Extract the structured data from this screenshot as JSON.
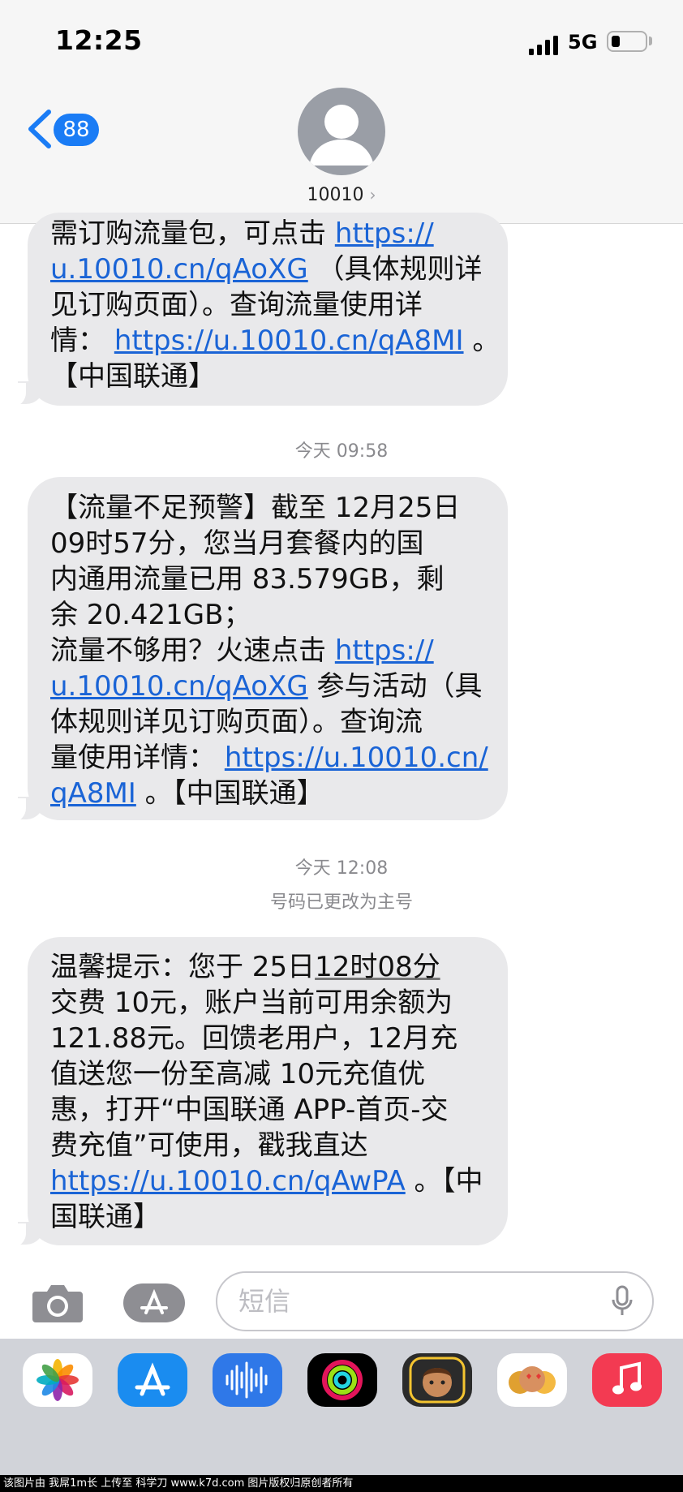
{
  "status_bar": {
    "time": "12:25",
    "carrier": "5G"
  },
  "header": {
    "badge_count": "88",
    "contact_name": "10010"
  },
  "messages": [
    {
      "lines": [
        [
          {
            "t": "需订购流量包，可点击 "
          },
          {
            "t": "https://",
            "link": true
          }
        ],
        [
          {
            "t": "u.10010.cn/qAoXG",
            "link": true
          },
          {
            "t": " （具体规则详"
          }
        ],
        [
          {
            "t": "见订购页面）。查询流量使用详"
          }
        ],
        [
          {
            "t": "情： "
          },
          {
            "t": "https://u.10010.cn/qA8MI",
            "link": true
          },
          {
            "t": " 。"
          }
        ],
        [
          {
            "t": "【中国联通】"
          }
        ]
      ]
    },
    {
      "lines": [
        [
          {
            "t": "【流量不足预警】截至 12月25日"
          }
        ],
        [
          {
            "t": "09时57分，您当月套餐内的国"
          }
        ],
        [
          {
            "t": "内通用流量已用 83.579GB，剩"
          }
        ],
        [
          {
            "t": "余 20.421GB；"
          }
        ],
        [
          {
            "t": "流量不够用？火速点击 "
          },
          {
            "t": "https://",
            "link": true
          }
        ],
        [
          {
            "t": "u.10010.cn/qAoXG",
            "link": true
          },
          {
            "t": " 参与活动（具"
          }
        ],
        [
          {
            "t": "体规则详见订购页面）。查询流"
          }
        ],
        [
          {
            "t": "量使用详情： "
          },
          {
            "t": "https://u.10010.cn/",
            "link": true
          }
        ],
        [
          {
            "t": "qA8MI",
            "link": true
          },
          {
            "t": " 。【中国联通】"
          }
        ]
      ]
    },
    {
      "lines": [
        [
          {
            "t": "温馨提示：您于 25日"
          },
          {
            "t": "12时08分",
            "under": true
          }
        ],
        [
          {
            "t": "交费 10元，账户当前可用余额为"
          }
        ],
        [
          {
            "t": "121.88元。回馈老用户，12月充"
          }
        ],
        [
          {
            "t": "值送您一份至高减 10元充值优"
          }
        ],
        [
          {
            "t": "惠，打开“中国联通 APP-首页-交"
          }
        ],
        [
          {
            "t": "费充值”可使用，戳我直达"
          }
        ],
        [
          {
            "t": "https://u.10010.cn/qAwPA",
            "link": true
          },
          {
            "t": " 。【中"
          }
        ],
        [
          {
            "t": "国联通】"
          }
        ]
      ]
    }
  ],
  "timestamps": {
    "t1": "今天 09:58",
    "t2": "今天 12:08",
    "number_note": "号码已更改为主号"
  },
  "input": {
    "placeholder": "短信"
  },
  "footer": {
    "text": "该图片由 我屌1m长 上传至 科学刀 www.k7d.com 图片版权归原创者所有"
  }
}
